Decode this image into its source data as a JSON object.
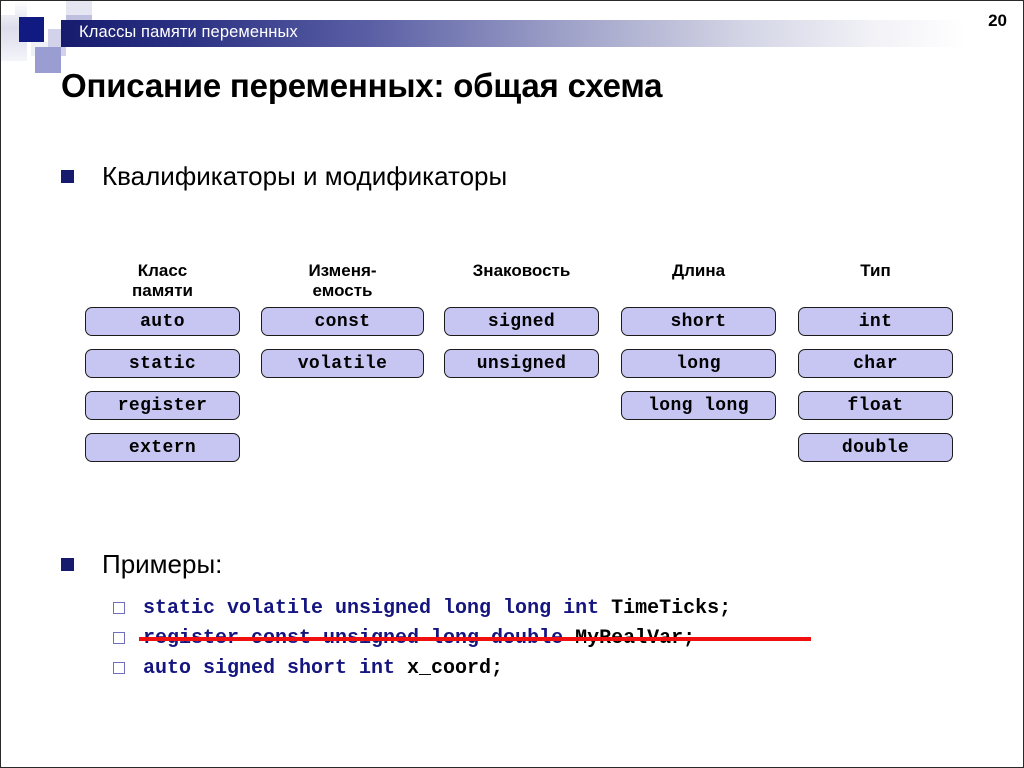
{
  "slide": {
    "page_number": "20",
    "header_title": "Классы памяти переменных",
    "title": "Описание переменных: общая схема"
  },
  "bullets": {
    "qualifiers": "Квалификаторы и модификаторы",
    "examples": "Примеры:"
  },
  "table": {
    "columns": [
      {
        "header": "Класс\nпамяти",
        "items": [
          "auto",
          "static",
          "register",
          "extern"
        ]
      },
      {
        "header": "Изменя-\nемость",
        "items": [
          "const",
          "volatile",
          "",
          ""
        ]
      },
      {
        "header": "Знаковость",
        "items": [
          "signed",
          "unsigned",
          "",
          ""
        ]
      },
      {
        "header": "Длина",
        "items": [
          "short",
          "long",
          "long long",
          ""
        ]
      },
      {
        "header": "Тип",
        "items": [
          "int",
          "char",
          "float",
          "double"
        ]
      }
    ]
  },
  "examples": [
    {
      "marker": "hollow-square-icon",
      "keywords": "static volatile unsigned long long int ",
      "identifier": "TimeTicks;",
      "struck_out": false
    },
    {
      "marker": "hollow-square-icon",
      "keywords": "register const unsigned long double ",
      "identifier": "MyRealVar;",
      "struck_out": true
    },
    {
      "marker": "hollow-square-icon",
      "keywords": "auto signed short int ",
      "identifier": "x_coord;",
      "struck_out": false
    }
  ],
  "colors": {
    "header_gradient_start": "#161b6e",
    "bullet_square": "#161b6e",
    "box_fill": "#c7c6f2",
    "box_border": "#1b1b1b",
    "keyword_blue": "#151580",
    "strikethrough_red": "#f01010",
    "marker_border": "#6f6fbb"
  }
}
